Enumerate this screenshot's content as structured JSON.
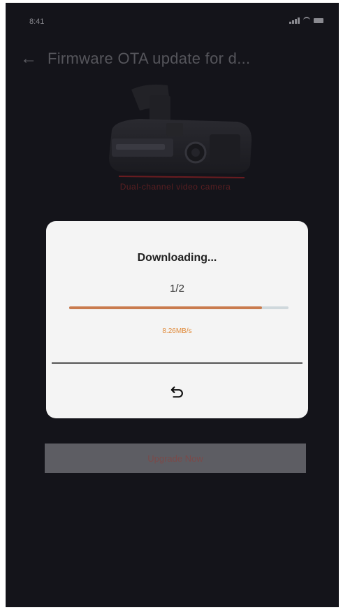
{
  "status_bar": {
    "time": "8:41"
  },
  "header": {
    "title": "Firmware OTA update for d..."
  },
  "device": {
    "label": "Dual-channel video camera"
  },
  "bottom_button": {
    "label": "Upgrade Now"
  },
  "dialog": {
    "title": "Downloading...",
    "count": "1/2",
    "progress": 0.88,
    "progress_text": "8.26MB/s",
    "action_icon": "undo-icon"
  },
  "colors": {
    "background": "#14141a",
    "dialog_bg": "#f4f4f4",
    "progress_fill": "#c97b4e",
    "progress_track": "#cfd8dc",
    "progress_text": "#e08a3a"
  }
}
